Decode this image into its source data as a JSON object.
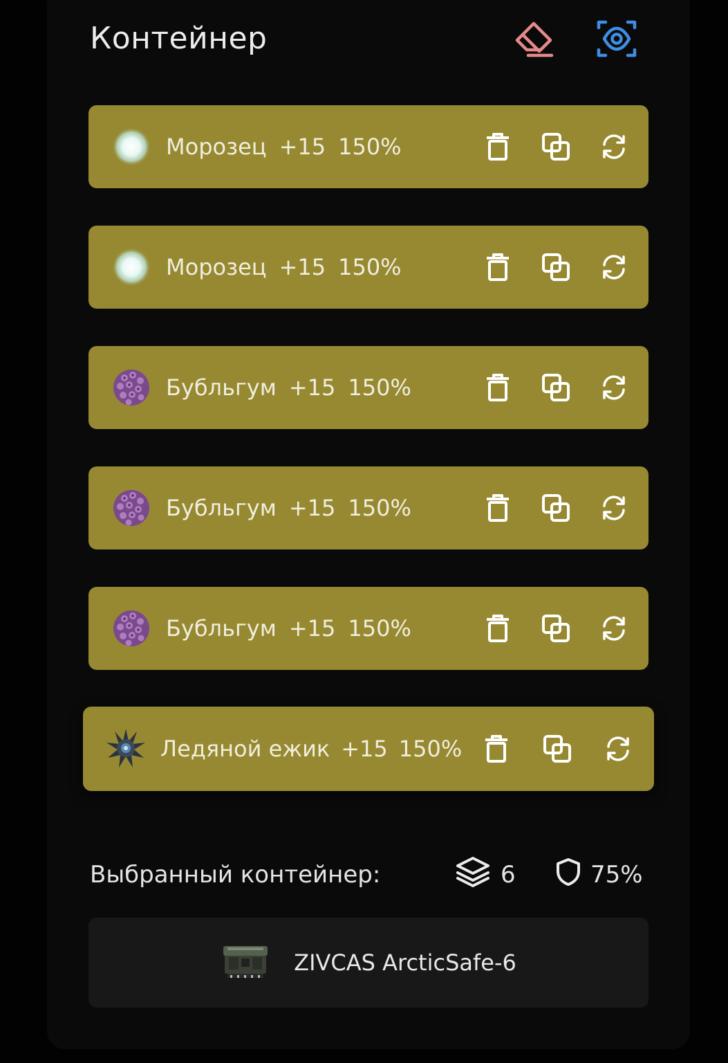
{
  "header": {
    "title": "Контейнер",
    "eraser_icon": "eraser-icon",
    "eye_icon": "eye-scan-icon",
    "eraser_color": "#e58a8a",
    "eye_color": "#3f8ee6"
  },
  "colors": {
    "row_background": "#978931",
    "panel_background": "#0a0a0a",
    "card_background": "#181818"
  },
  "items": [
    {
      "name": "Морозец",
      "level": "+15",
      "percent": "150%",
      "icon": "frost-orb-icon"
    },
    {
      "name": "Морозец",
      "level": "+15",
      "percent": "150%",
      "icon": "frost-orb-icon"
    },
    {
      "name": "Бубльгум",
      "level": "+15",
      "percent": "150%",
      "icon": "bubblegum-icon"
    },
    {
      "name": "Бубльгум",
      "level": "+15",
      "percent": "150%",
      "icon": "bubblegum-icon"
    },
    {
      "name": "Бубльгум",
      "level": "+15",
      "percent": "150%",
      "icon": "bubblegum-icon"
    },
    {
      "name": "Ледяной ежик",
      "level": "+15",
      "percent": "150%",
      "icon": "ice-hedgehog-icon"
    }
  ],
  "row_actions": [
    "trash-icon",
    "copy-icon",
    "refresh-icon"
  ],
  "selected": {
    "label": "Выбранный контейнер:",
    "slots": "6",
    "protection": "75%",
    "container_name": "ZIVCAS ArcticSafe-6",
    "container_icon": "container-icon"
  }
}
